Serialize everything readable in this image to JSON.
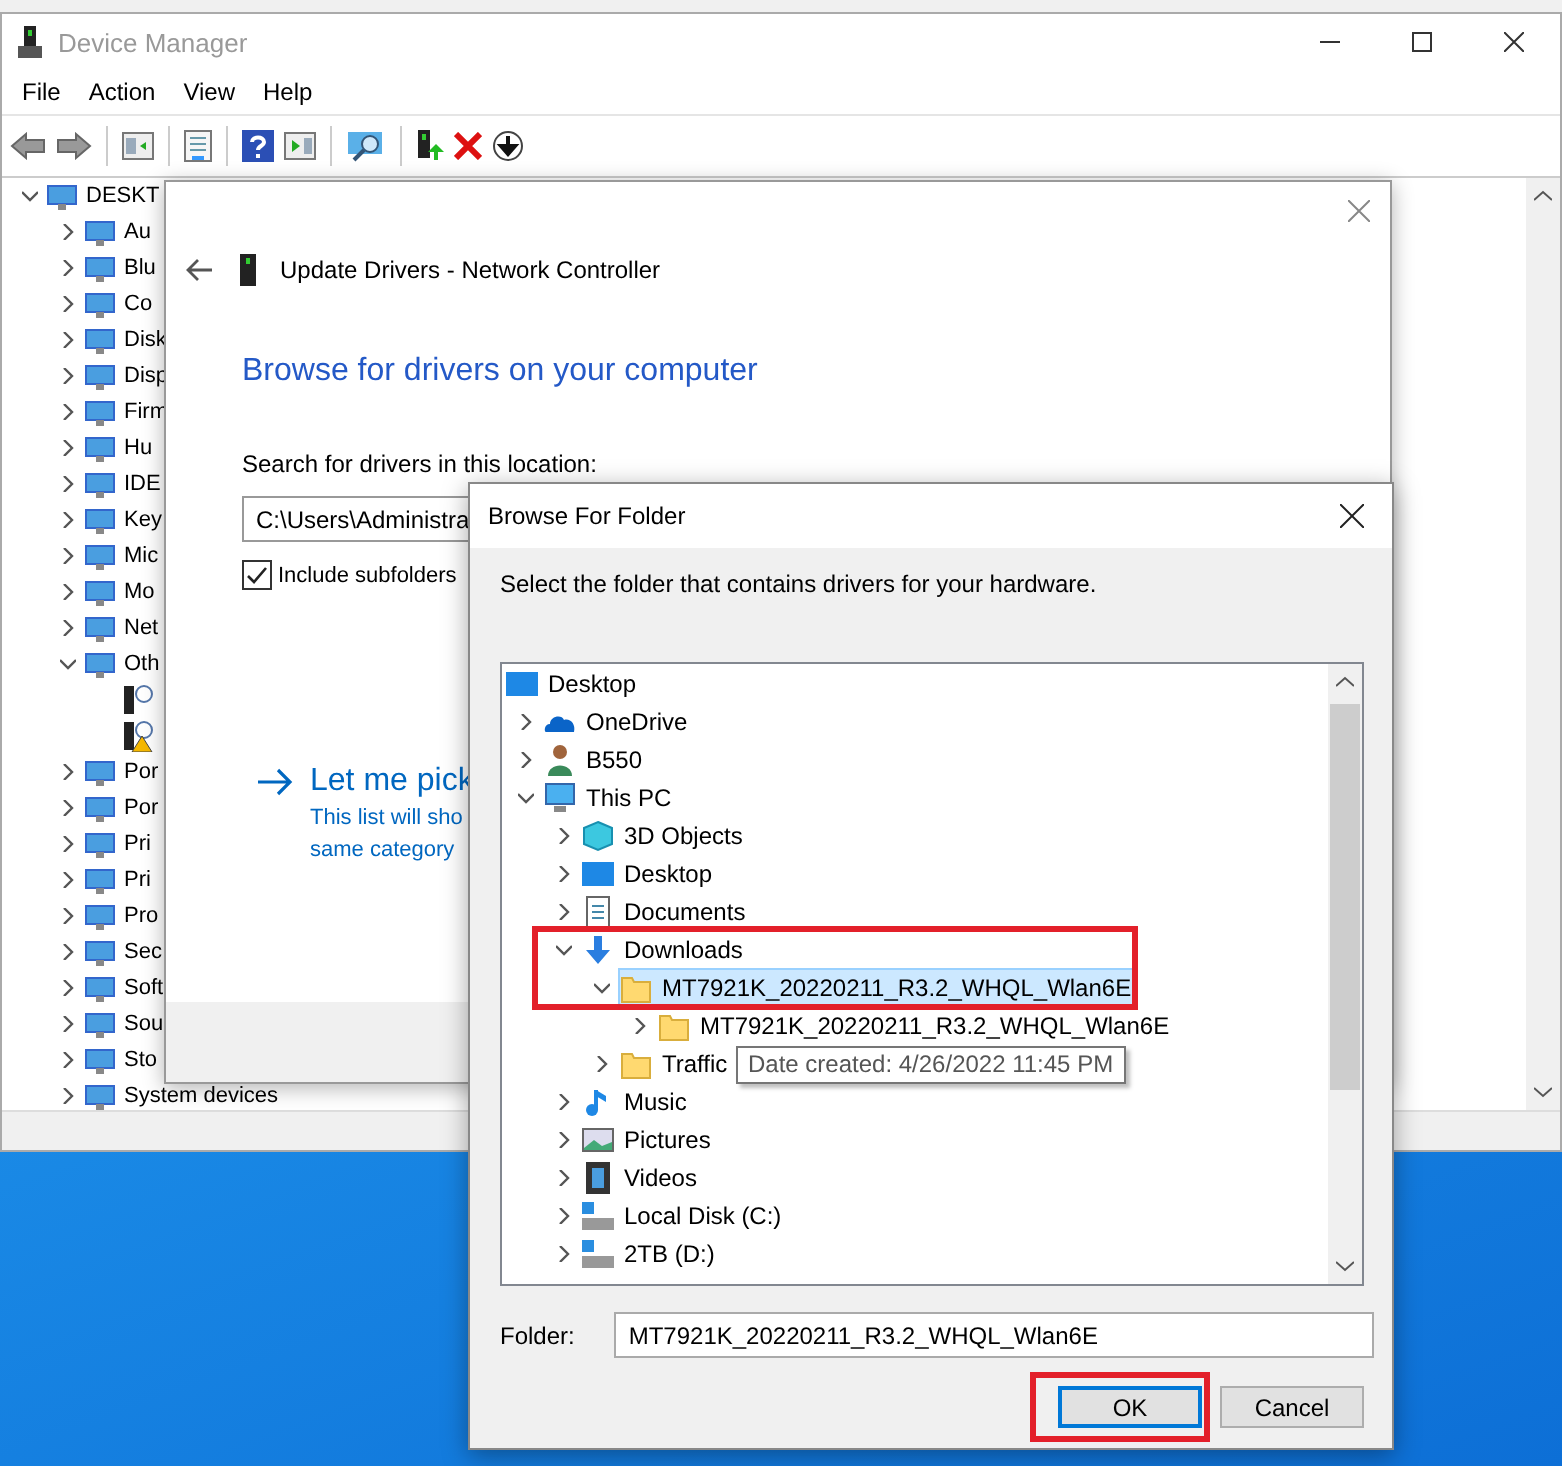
{
  "device_manager": {
    "title": "Device Manager",
    "menu": [
      "File",
      "Action",
      "View",
      "Help"
    ],
    "tree": [
      {
        "label": "DESKT",
        "expanded": true,
        "children": [
          {
            "label": "Au",
            "expanded": false
          },
          {
            "label": "Blu",
            "expanded": false
          },
          {
            "label": "Co",
            "expanded": false
          },
          {
            "label": "Disk",
            "expanded": false
          },
          {
            "label": "Disp",
            "expanded": false
          },
          {
            "label": "Firm",
            "expanded": false
          },
          {
            "label": "Hu",
            "expanded": false
          },
          {
            "label": "IDE",
            "expanded": false
          },
          {
            "label": "Key",
            "expanded": false
          },
          {
            "label": "Mic",
            "expanded": false
          },
          {
            "label": "Mo",
            "expanded": false
          },
          {
            "label": "Net",
            "expanded": false
          },
          {
            "label": "Oth",
            "expanded": true,
            "children": [
              {
                "warning": false
              },
              {
                "warning": true
              }
            ]
          },
          {
            "label": "Por",
            "expanded": false
          },
          {
            "label": "Por",
            "expanded": false
          },
          {
            "label": "Pri",
            "expanded": false
          },
          {
            "label": "Pri",
            "expanded": false
          },
          {
            "label": "Pro",
            "expanded": false
          },
          {
            "label": "Sec",
            "expanded": false
          },
          {
            "label": "Soft",
            "expanded": false
          },
          {
            "label": "Sou",
            "expanded": false
          },
          {
            "label": "Sto",
            "expanded": false
          },
          {
            "label": "System devices",
            "expanded": false
          }
        ]
      }
    ]
  },
  "update_drivers": {
    "title": "Update Drivers - Network Controller",
    "heading": "Browse for drivers on your computer",
    "location_label": "Search for drivers in this location:",
    "location_value": "C:\\Users\\Administra",
    "include_subfolders": {
      "label": "Include subfolders",
      "checked": true
    },
    "pick": {
      "title": "Let me pick",
      "lines": [
        "This list will sho",
        "same category"
      ]
    }
  },
  "browse_folder": {
    "title": "Browse For Folder",
    "instruction": "Select the folder that contains drivers for your hardware.",
    "tree": [
      {
        "label": "Desktop",
        "kind": "desktop",
        "selected": false,
        "children": [
          {
            "label": "OneDrive",
            "kind": "cloud",
            "expanded": false,
            "selected": false
          },
          {
            "label": "B550",
            "kind": "user",
            "expanded": false,
            "selected": false
          },
          {
            "label": "This PC",
            "kind": "computer",
            "expanded": true,
            "selected": false,
            "children": [
              {
                "label": "3D Objects",
                "kind": "cube",
                "expanded": false,
                "selected": false
              },
              {
                "label": "Desktop",
                "kind": "desktop",
                "expanded": false,
                "selected": false
              },
              {
                "label": "Documents",
                "kind": "document",
                "expanded": false,
                "selected": false
              },
              {
                "label": "Downloads",
                "kind": "download",
                "expanded": true,
                "selected": false,
                "children": [
                  {
                    "label": "MT7921K_20220211_R3.2_WHQL_Wlan6E",
                    "kind": "folder",
                    "expanded": true,
                    "selected": true,
                    "children": [
                      {
                        "label": "MT7921K_20220211_R3.2_WHQL_Wlan6E",
                        "kind": "folder",
                        "expanded": false,
                        "selected": false
                      }
                    ]
                  },
                  {
                    "label": "Traffic",
                    "kind": "folder",
                    "expanded": false,
                    "selected": false
                  }
                ]
              },
              {
                "label": "Music",
                "kind": "music",
                "expanded": false,
                "selected": false
              },
              {
                "label": "Pictures",
                "kind": "picture",
                "expanded": false,
                "selected": false
              },
              {
                "label": "Videos",
                "kind": "video",
                "expanded": false,
                "selected": false
              },
              {
                "label": "Local Disk (C:)",
                "kind": "drive",
                "expanded": false,
                "selected": false
              },
              {
                "label": "2TB (D:)",
                "kind": "drive",
                "expanded": false,
                "selected": false
              }
            ]
          }
        ]
      }
    ],
    "tooltip": "Date created: 4/26/2022 11:45 PM",
    "folder_label": "Folder:",
    "folder_value": "MT7921K_20220211_R3.2_WHQL_Wlan6E",
    "buttons": [
      {
        "label": "OK",
        "default": true
      },
      {
        "label": "Cancel",
        "default": false
      }
    ]
  }
}
